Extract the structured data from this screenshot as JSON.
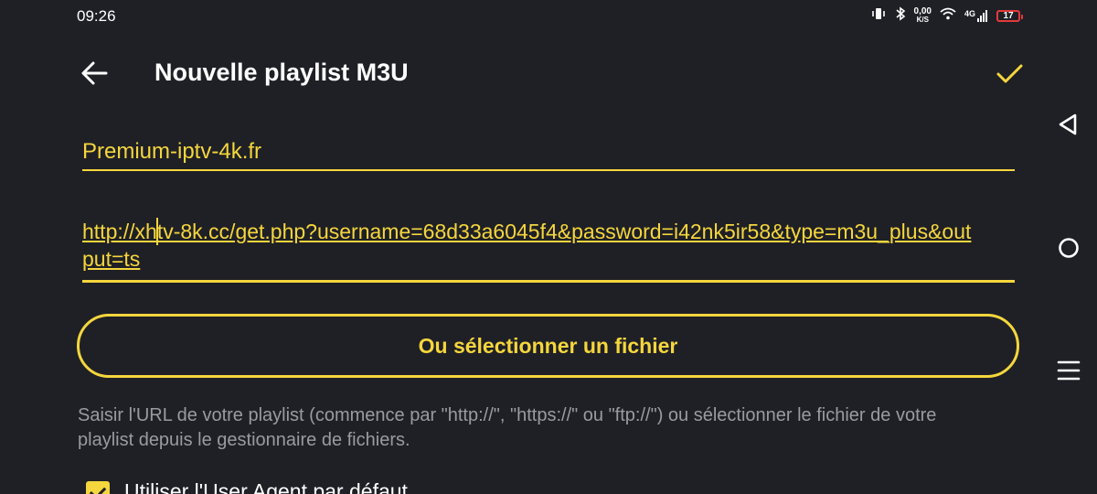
{
  "status_bar": {
    "time": "09:26",
    "speed_value": "0,00",
    "speed_unit": "K/S",
    "network": "4G",
    "battery": "17",
    "icons": [
      "vibrate-icon",
      "bluetooth-icon",
      "wifi-icon",
      "signal-icon",
      "battery-icon"
    ]
  },
  "header": {
    "title": "Nouvelle playlist M3U",
    "back_icon": "arrow-left-icon",
    "confirm_icon": "check-icon"
  },
  "form": {
    "name_value": "Premium-iptv-4k.fr",
    "url_value": "http://xhtv-8k.cc/get.php?username=68d33a6045f4&password=i42nk5ir58&type=m3u_plus&output=ts",
    "select_file_label": "Ou sélectionner un fichier",
    "help_text": "Saisir l'URL de votre playlist (commence par \"http://\", \"https://\" ou \"ftp://\") ou sélectionner le fichier de votre playlist depuis le gestionnaire de fichiers.",
    "user_agent_label": "Utiliser l'User Agent par défaut",
    "user_agent_checked": true
  },
  "nav_bar": {
    "buttons": [
      "back-triangle-icon",
      "home-circle-icon",
      "menu-lines-icon"
    ]
  },
  "colors": {
    "background": "#1f2026",
    "accent": "#f5d63d",
    "help_text": "#9a9ba1",
    "battery": "#e23b3b"
  }
}
